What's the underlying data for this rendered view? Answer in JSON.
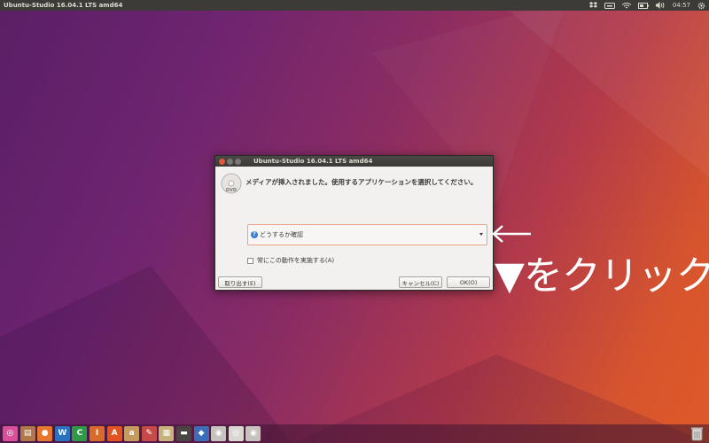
{
  "top_panel": {
    "window_title": "Ubuntu-Studio 16.04.1 LTS amd64",
    "clock": "04:57"
  },
  "dialog": {
    "title": "Ubuntu-Studio 16.04.1 LTS amd64",
    "media_icon_label": "DVD",
    "message": "メディアが挿入されました。使用するアプリケーションを選択してください。",
    "action_select": {
      "value": "どうするか確認"
    },
    "always_checkbox_label": "常にこの動作を実施する(A)",
    "eject_button": "取り出す(E)",
    "cancel_button": "キャンセル(C)",
    "ok_button": "OK(O)"
  },
  "annotation": {
    "arrow": "←",
    "text": "▼をクリック"
  },
  "launcher": {
    "apps": [
      {
        "name": "dash-icon",
        "glyph": "◎",
        "color": "#d9509a"
      },
      {
        "name": "files-icon",
        "glyph": "▤",
        "color": "#b07848"
      },
      {
        "name": "firefox-icon",
        "glyph": "●",
        "color": "#e8772e"
      },
      {
        "name": "writer-icon",
        "glyph": "W",
        "color": "#2a71c0"
      },
      {
        "name": "calc-icon",
        "glyph": "C",
        "color": "#2e9a48"
      },
      {
        "name": "impress-icon",
        "glyph": "I",
        "color": "#d86a2c"
      },
      {
        "name": "software-center-icon",
        "glyph": "A",
        "color": "#e3531f"
      },
      {
        "name": "amazon-icon",
        "glyph": "a",
        "color": "#c59a5e"
      },
      {
        "name": "system-settings-icon",
        "glyph": "✎",
        "color": "#c64a4a"
      },
      {
        "name": "archive-icon",
        "glyph": "▦",
        "color": "#c5b27d"
      },
      {
        "name": "kdenlive-icon",
        "glyph": "▬",
        "color": "#4a4542"
      },
      {
        "name": "cinelerra-icon",
        "glyph": "◆",
        "color": "#3e6db8"
      },
      {
        "name": "disc-icon",
        "glyph": "◉",
        "color": "#c6c3be"
      },
      {
        "name": "dvd-drive-icon",
        "glyph": "◎",
        "color": "#d9d7d2"
      },
      {
        "name": "cd-icon",
        "glyph": "◉",
        "color": "#c6c3be"
      }
    ]
  }
}
